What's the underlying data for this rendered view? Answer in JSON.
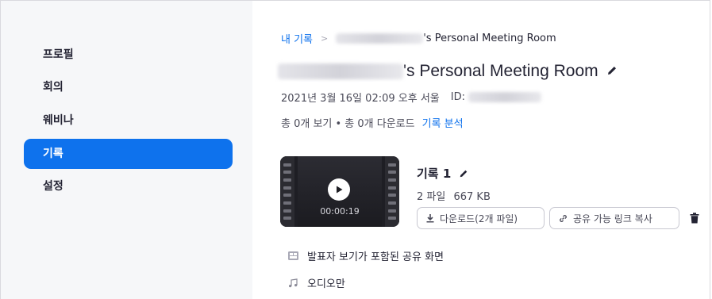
{
  "sidebar": {
    "items": [
      {
        "label": "프로필",
        "active": false
      },
      {
        "label": "회의",
        "active": false
      },
      {
        "label": "웨비나",
        "active": false
      },
      {
        "label": "기록",
        "active": true
      },
      {
        "label": "설정",
        "active": false
      }
    ]
  },
  "breadcrumb": {
    "root": "내 기록",
    "separator": ">",
    "current_suffix": "'s Personal Meeting Room"
  },
  "meeting": {
    "title_suffix": "'s Personal Meeting Room",
    "datetime": "2021년 3월 16일 02:09 오후 서울",
    "id_label": "ID:",
    "stats": "총 0개 보기 • 총 0개 다운로드",
    "analytics_link": "기록 분석"
  },
  "recording": {
    "title": "기록 1",
    "duration": "00:00:19",
    "file_count": "2 파일",
    "size": "667 KB",
    "download_button": "다운로드(2개 파일)",
    "share_button": "공유 가능 링크 복사"
  },
  "files": [
    {
      "icon": "screen-share-icon",
      "label": "발표자 보기가 포함된 공유 화면"
    },
    {
      "icon": "music-note-icon",
      "label": "오디오만"
    }
  ],
  "colors": {
    "accent": "#0e72ed",
    "sidebar_bg": "#f6f7f9",
    "text": "#232333"
  }
}
